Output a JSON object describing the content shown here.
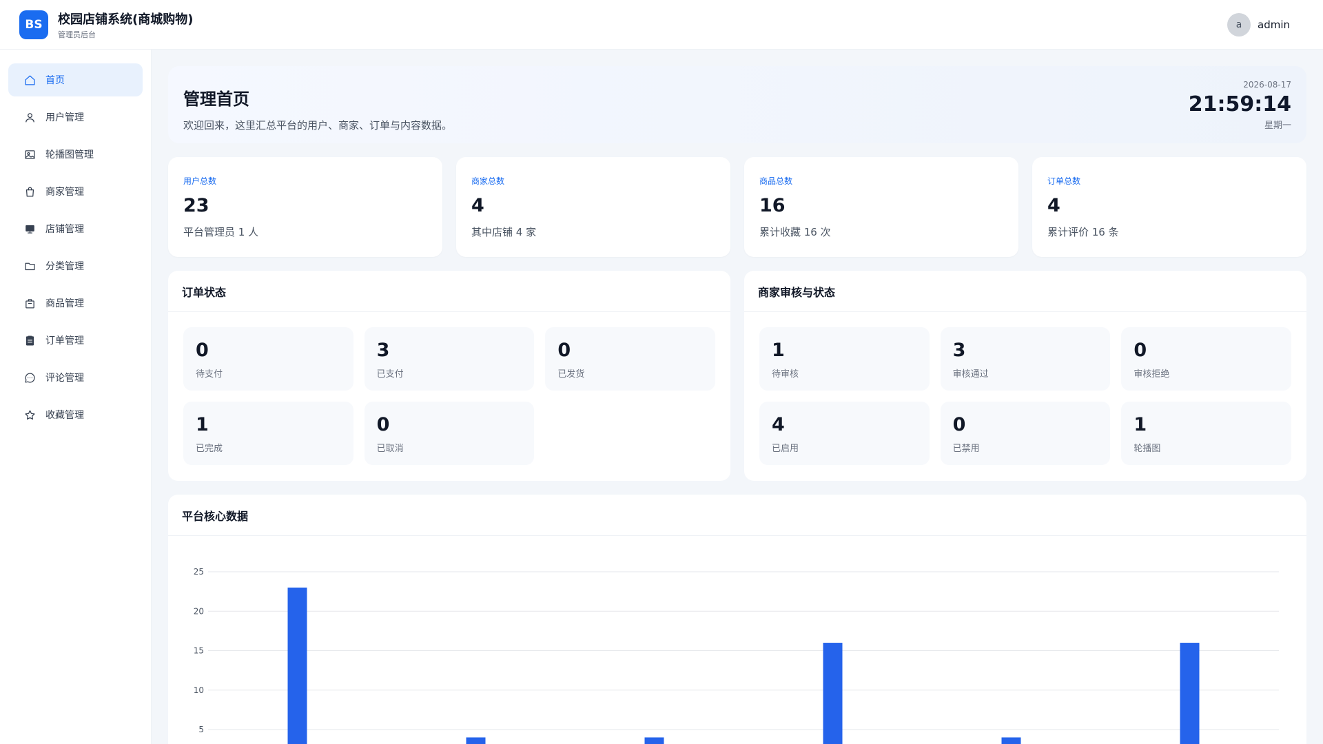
{
  "header": {
    "logo_text": "BS",
    "title": "校园店铺系统(商城购物)",
    "subtitle": "管理员后台",
    "avatar_letter": "a",
    "username": "admin"
  },
  "sidebar": {
    "items": [
      {
        "label": "首页",
        "icon": "home-icon",
        "active": true
      },
      {
        "label": "用户管理",
        "icon": "user-icon"
      },
      {
        "label": "轮播图管理",
        "icon": "image-icon"
      },
      {
        "label": "商家管理",
        "icon": "bag-icon"
      },
      {
        "label": "店铺管理",
        "icon": "store-icon"
      },
      {
        "label": "分类管理",
        "icon": "folder-icon"
      },
      {
        "label": "商品管理",
        "icon": "box-icon"
      },
      {
        "label": "订单管理",
        "icon": "clipboard-icon"
      },
      {
        "label": "评论管理",
        "icon": "comment-icon"
      },
      {
        "label": "收藏管理",
        "icon": "star-icon"
      }
    ]
  },
  "welcome": {
    "title": "管理首页",
    "text": "欢迎回来，这里汇总平台的用户、商家、订单与内容数据。",
    "date": "2026-08-17",
    "time": "21:59:14",
    "weekday": "星期一"
  },
  "stats": [
    {
      "label": "用户总数",
      "value": "23",
      "sub": "平台管理员 1 人"
    },
    {
      "label": "商家总数",
      "value": "4",
      "sub": "其中店铺 4 家"
    },
    {
      "label": "商品总数",
      "value": "16",
      "sub": "累计收藏 16 次"
    },
    {
      "label": "订单总数",
      "value": "4",
      "sub": "累计评价 16 条"
    }
  ],
  "order_status": {
    "title": "订单状态",
    "items": [
      {
        "num": "0",
        "label": "待支付"
      },
      {
        "num": "3",
        "label": "已支付"
      },
      {
        "num": "0",
        "label": "已发货"
      },
      {
        "num": "1",
        "label": "已完成"
      },
      {
        "num": "0",
        "label": "已取消"
      }
    ]
  },
  "merchant_status": {
    "title": "商家审核与状态",
    "items": [
      {
        "num": "1",
        "label": "待审核"
      },
      {
        "num": "3",
        "label": "审核通过"
      },
      {
        "num": "0",
        "label": "审核拒绝"
      },
      {
        "num": "4",
        "label": "已启用"
      },
      {
        "num": "0",
        "label": "已禁用"
      },
      {
        "num": "1",
        "label": "轮播图"
      }
    ]
  },
  "chart_panel": {
    "title": "平台核心数据"
  },
  "colors": {
    "accent": "#1a6cf0",
    "bar": "#2563eb"
  },
  "chart_data": {
    "type": "bar",
    "title": "",
    "values": [
      23,
      4,
      4,
      16,
      4,
      16
    ],
    "ylim": [
      0,
      25
    ],
    "yticks": [
      5,
      10,
      15,
      20,
      25
    ],
    "grid": true
  }
}
